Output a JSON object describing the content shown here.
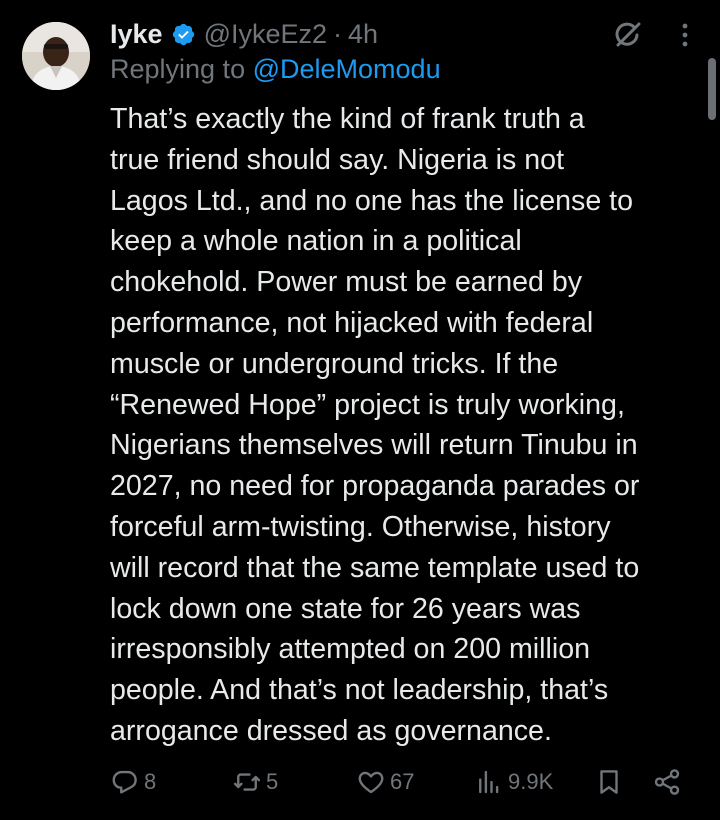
{
  "author": {
    "name": "Iyke",
    "handle": "@IykeEz2",
    "separator": "·",
    "time": "4h",
    "verified": true
  },
  "reply": {
    "prefix": "Replying to ",
    "mention": "@DeleMomodu"
  },
  "body_lines": [
    "That’s exactly the kind of frank truth a",
    "true friend should say. Nigeria is not",
    "Lagos Ltd., and no one has the license to",
    "keep a whole nation in a political",
    "chokehold. Power must be earned by",
    "performance, not hijacked with federal",
    "muscle or underground tricks. If the",
    "“Renewed Hope” project is truly working,",
    "Nigerians themselves will return Tinubu in",
    "2027, no need for propaganda parades or",
    "forceful arm-twisting. Otherwise, history",
    "will record that the same template used to",
    "lock down one state for 26 years was",
    "irresponsibly attempted on 200 million",
    "people. And that’s not leadership, that’s",
    "arrogance dressed as governance."
  ],
  "actions": {
    "replies": "8",
    "reposts": "5",
    "likes": "67",
    "views": "9.9K"
  },
  "icons": {
    "verified": "verified-badge-icon",
    "grok": "grok-icon",
    "more": "more-icon",
    "reply": "reply-icon",
    "repost": "repost-icon",
    "like": "heart-icon",
    "views": "views-icon",
    "bookmark": "bookmark-icon",
    "share": "share-icon"
  },
  "colors": {
    "background": "#000000",
    "text": "#e7e9ea",
    "muted": "#71767b",
    "accent": "#1d9bf0"
  }
}
